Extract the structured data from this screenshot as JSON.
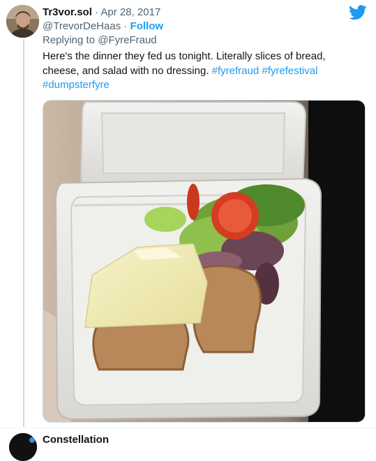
{
  "tweet": {
    "author_name": "Tr3vor.sol",
    "separator": "·",
    "date": "Apr 28, 2017",
    "handle": "@TrevorDeHaas",
    "handle_separator": "·",
    "follow_label": "Follow",
    "reply_prefix": "Replying to",
    "reply_target": "@FyreFraud",
    "body_text": "Here's the dinner they fed us tonight. Literally slices of bread, cheese, and salad with no dressing.",
    "hashtags": [
      "#fyrefraud",
      "#fyrefestival",
      "#dumpsterfyre"
    ],
    "twitter_icon": "twitter-bird-icon",
    "brand_color": "#1d9bf0"
  },
  "next_tweet": {
    "author_name_partial": "Constellation"
  }
}
